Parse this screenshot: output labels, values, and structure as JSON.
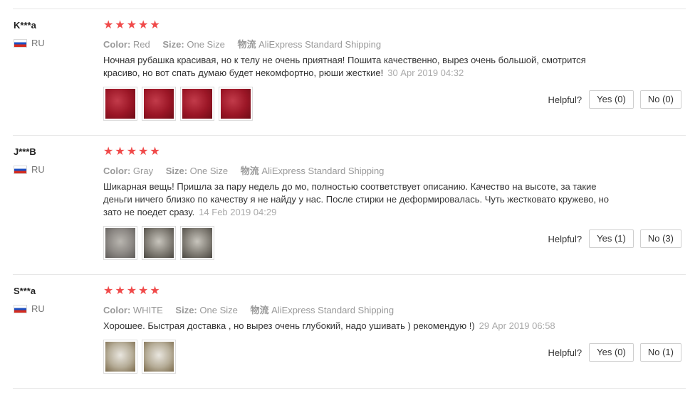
{
  "labels": {
    "color": "Color:",
    "size": "Size:",
    "shipping": "物流",
    "helpful": "Helpful?"
  },
  "colors": {
    "star": "#f04a4a"
  },
  "reviews": [
    {
      "user": "K***a",
      "country": "RU",
      "rating": 5,
      "color": "Red",
      "size": "One Size",
      "shipping": "AliExpress Standard Shipping",
      "text": "Ночная рубашка красивая, но к телу не очень приятная! Пошита качественно, вырез очень большой, смотрится красиво, но вот спать думаю будет некомфортно, рюши жесткие!",
      "date": "30 Apr 2019 04:32",
      "photos": 4,
      "yes": "Yes (0)",
      "no": "No (0)"
    },
    {
      "user": "J***B",
      "country": "RU",
      "rating": 5,
      "color": "Gray",
      "size": "One Size",
      "shipping": "AliExpress Standard Shipping",
      "text": "Шикарная вещь! Пришла за пару недель до мо, полностью соответствует описанию. Качество на высоте, за такие деньги ничего близко по качеству я не найду у нас. После стирки не деформировалась. Чуть жестковато кружево, но зато не поедет сразу.",
      "date": "14 Feb 2019 04:29",
      "photos": 3,
      "yes": "Yes (1)",
      "no": "No (3)"
    },
    {
      "user": "S***a",
      "country": "RU",
      "rating": 5,
      "color": "WHITE",
      "size": "One Size",
      "shipping": "AliExpress Standard Shipping",
      "text": "Хорошее. Быстрая доставка , но вырез очень глубокий, надо ушивать ) рекомендую !)",
      "date": "29 Apr 2019 06:58",
      "photos": 2,
      "yes": "Yes (0)",
      "no": "No (1)"
    }
  ]
}
